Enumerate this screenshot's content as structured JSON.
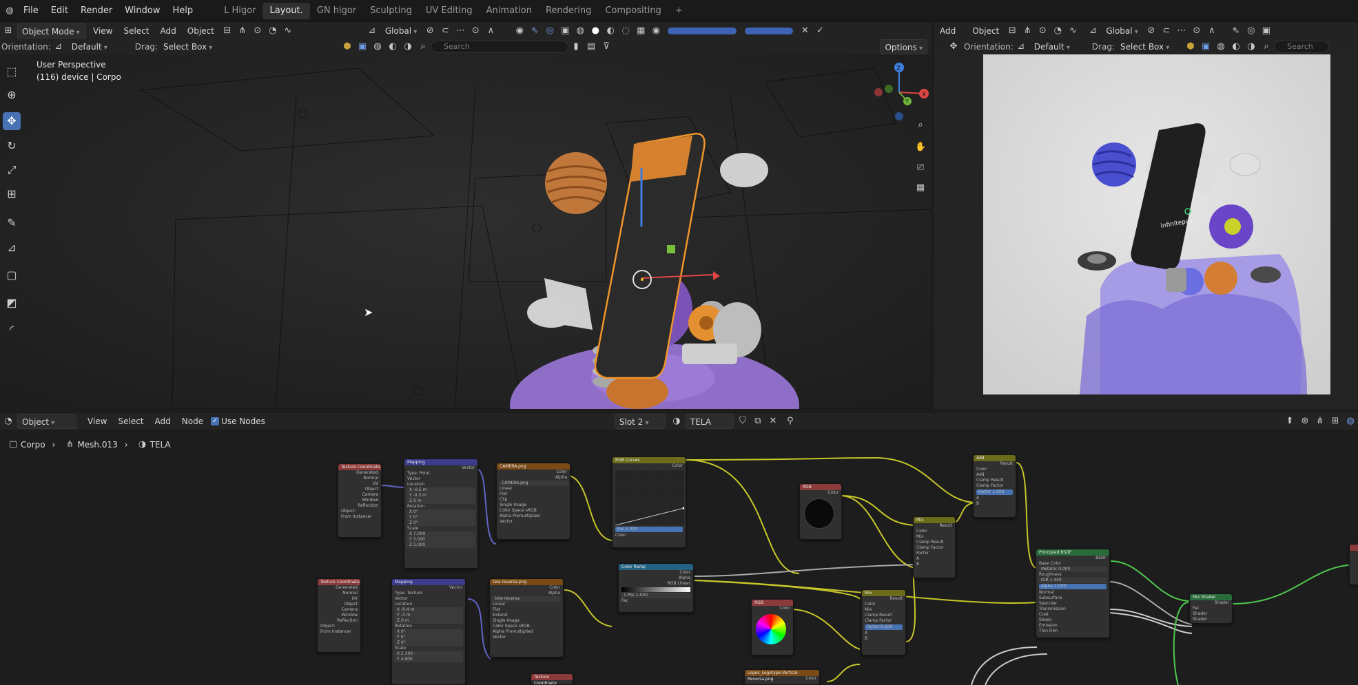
{
  "topbar": {
    "menus": [
      "File",
      "Edit",
      "Render",
      "Window",
      "Help"
    ],
    "workspaces": [
      "L Higor",
      "Layout.",
      "GN higor",
      "Sculpting",
      "UV Editing",
      "Animation",
      "Rendering",
      "Compositing"
    ],
    "active_workspace": "Layout.",
    "add_tab": "+"
  },
  "viewport_header": {
    "mode": "Object Mode",
    "menus": [
      "View",
      "Select",
      "Add",
      "Object"
    ],
    "transform": "Global",
    "orientation_label": "Orientation:",
    "orientation_value": "Default",
    "drag_label": "Drag:",
    "drag_value": "Select Box",
    "search_placeholder": "Search",
    "options": "Options"
  },
  "viewport": {
    "title": "User Perspective",
    "subtitle": "(116) device | Corpo"
  },
  "right_viewport_header": {
    "menus": [
      "Add",
      "Object"
    ],
    "transform": "Global",
    "orientation_label": "Orientation:",
    "orientation_value": "Default",
    "drag_label": "Drag:",
    "drag_value": "Select Box",
    "search_placeholder": "Search"
  },
  "render_preview": {
    "brand_text": "infinitepay"
  },
  "node_header": {
    "mode": "Object",
    "menus": [
      "View",
      "Select",
      "Add",
      "Node"
    ],
    "use_nodes": "Use Nodes",
    "slot": "Slot 2",
    "material": "TELA"
  },
  "breadcrumb": [
    "Corpo",
    "Mesh.013",
    "TELA"
  ],
  "nodes": [
    {
      "title": "Texture Coordinate",
      "rows": [
        "Generated",
        "Normal",
        "UV",
        "Object",
        "Camera",
        "Window",
        "Reflection",
        "Object:",
        "From Instancer"
      ]
    },
    {
      "title": "Mapping",
      "rows": [
        "Vector",
        "Type:  Point",
        "Vector",
        "Location",
        "X  -0.5 m",
        "Y  -0.3 m",
        "Z  0 m",
        "Rotation",
        "X  0°",
        "Y  0°",
        "Z  0°",
        "Scale",
        "X  7.000",
        "Y  3.000",
        "Z  1.000"
      ]
    },
    {
      "title": "CAMERA.png",
      "rows": [
        "Color",
        "Alpha",
        "CAMERA.png",
        "Linear",
        "Flat",
        "Clip",
        "Single Image",
        "Color Space  sRGB",
        "Alpha  Premultiplied",
        "Vector"
      ]
    },
    {
      "title": "RGB Curves",
      "rows": [
        "Color",
        "Fac  1.000",
        "Color"
      ]
    },
    {
      "title": "RGB",
      "rows": [
        "Color"
      ]
    },
    {
      "title": "Add",
      "rows": [
        "Result",
        "Color",
        "Add",
        "Clamp Result",
        "Clamp Factor",
        "Factor  1.000",
        "A",
        "B"
      ]
    },
    {
      "title": "Mix",
      "rows": [
        "Result",
        "Color",
        "Mix",
        "Clamp Result",
        "Clamp Factor",
        "Factor",
        "A",
        "B"
      ]
    },
    {
      "title": "Principled BSDF",
      "rows": [
        "BSDF",
        "Base Color",
        "Metallic  0.000",
        "Roughness",
        "IOR  1.450",
        "Alpha  1.000",
        "Normal",
        "Subsurface",
        "Specular",
        "Transmission",
        "Coat",
        "Sheen",
        "Emission",
        "Thin Film"
      ]
    },
    {
      "title": "Texture Coordinate",
      "rows": [
        "Generated",
        "Normal",
        "UV",
        "Object",
        "Camera",
        "Window",
        "Reflection",
        "Object:",
        "From Instancer"
      ]
    },
    {
      "title": "Mapping",
      "rows": [
        "Vector",
        "Type:  Texture",
        "Vector",
        "Location",
        "X  -0.4 m",
        "Y  -3 m",
        "Z  0 m",
        "Rotation",
        "X  0°",
        "Y  0°",
        "Z  0°",
        "Scale",
        "X  2.300",
        "Y  4.900"
      ]
    },
    {
      "title": "tela-reversa.png",
      "rows": [
        "Color",
        "Alpha",
        "tela-reversa",
        "Linear",
        "Flat",
        "Extend",
        "Single Image",
        "Color Space  sRGB",
        "Alpha  Premultiplied",
        "Vector"
      ]
    },
    {
      "title": "Color Ramp",
      "rows": [
        "Color",
        "Alpha",
        "RGB  Linear",
        "1  Pos  1.000",
        "Fac"
      ]
    },
    {
      "title": "RGB",
      "rows": [
        "Color"
      ]
    },
    {
      "title": "Mix",
      "rows": [
        "Result",
        "Color",
        "Mix",
        "Clamp Result",
        "Clamp Factor",
        "Factor  0.500",
        "A",
        "B"
      ]
    },
    {
      "title": "Mix Shader",
      "rows": [
        "Shader",
        "Fac",
        "Shader",
        "Shader"
      ]
    },
    {
      "title": "Logos_Logotype-Vertical-Reversa.png",
      "rows": [
        "Color"
      ]
    },
    {
      "title": "Texture Coordinate",
      "rows": []
    }
  ],
  "colors": {
    "accent": "#4772b3",
    "selection_orange": "#f0952a",
    "node_texture": "#8c3a3a",
    "node_vector": "#3b3b8c",
    "node_image": "#7a4a16",
    "node_color": "#6b6b1a",
    "node_shader": "#2a6b3a",
    "node_converter": "#246283"
  }
}
